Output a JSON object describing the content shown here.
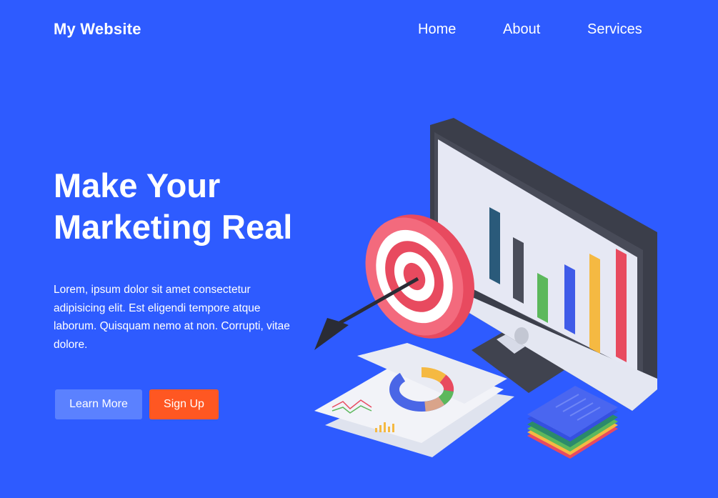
{
  "header": {
    "logo": "My Website",
    "nav": [
      {
        "label": "Home"
      },
      {
        "label": "About"
      },
      {
        "label": "Services"
      }
    ]
  },
  "hero": {
    "title_line1": "Make Your",
    "title_line2": "Marketing Real",
    "description": "Lorem, ipsum dolor sit amet consectetur adipisicing elit. Est eligendi tempore atque laborum. Quisquam nemo at non. Corrupti, vitae dolore.",
    "buttons": {
      "learn_more": "Learn More",
      "sign_up": "Sign Up"
    }
  },
  "colors": {
    "background": "#2e5bff",
    "learn_more_button": "#5b81ff",
    "sign_up_button": "#ff5722"
  }
}
